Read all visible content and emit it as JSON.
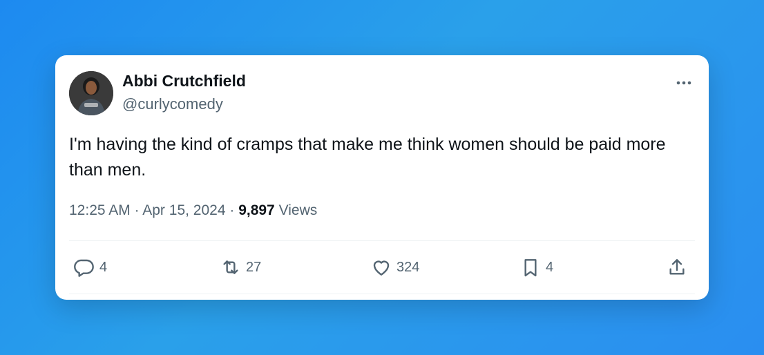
{
  "author": {
    "name": "Abbi Crutchfield",
    "handle": "@curlycomedy"
  },
  "tweet": {
    "text": "I'm having the kind of cramps that make me think women should be paid more than men.",
    "time": "12:25 AM",
    "date": "Apr 15, 2024",
    "views_count": "9,897",
    "views_label": "Views"
  },
  "actions": {
    "replies": "4",
    "retweets": "27",
    "likes": "324",
    "bookmarks": "4"
  },
  "colors": {
    "background_gradient": [
      "#1d8af0",
      "#2aa0ea"
    ],
    "card": "#ffffff",
    "text_primary": "#0f1419",
    "text_secondary": "#536471"
  },
  "icons": [
    "more-icon",
    "reply-icon",
    "retweet-icon",
    "like-icon",
    "bookmark-icon",
    "share-icon"
  ]
}
